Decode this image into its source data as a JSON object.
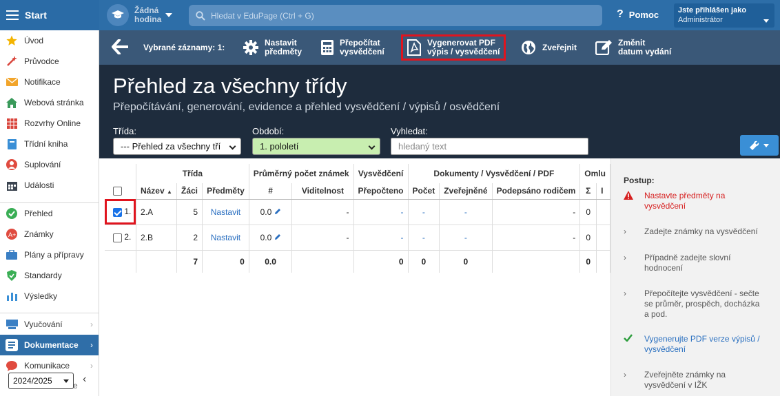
{
  "topbar": {
    "brand": "Start",
    "lesson_line1": "Žádná",
    "lesson_line2": "hodina",
    "search_placeholder": "Hledat v EduPage (Ctrl + G)",
    "help": "Pomoc",
    "login_line1": "Jste přihlášen jako",
    "login_line2": "Administrátor"
  },
  "sidebar": {
    "items": [
      {
        "label": "Úvod",
        "icon": "star-icon"
      },
      {
        "label": "Průvodce",
        "icon": "wand-icon"
      },
      {
        "label": "Notifikace",
        "icon": "envelope-icon"
      },
      {
        "label": "Webová stránka",
        "icon": "house-icon"
      },
      {
        "label": "Rozvrhy Online",
        "icon": "timetable-icon"
      },
      {
        "label": "Třídní kniha",
        "icon": "book-icon"
      },
      {
        "label": "Suplování",
        "icon": "person-icon"
      },
      {
        "label": "Události",
        "icon": "calendar-icon"
      },
      {
        "label": "Přehled",
        "icon": "check-circle-icon"
      },
      {
        "label": "Známky",
        "icon": "grades-icon"
      },
      {
        "label": "Plány a přípravy",
        "icon": "briefcase-icon"
      },
      {
        "label": "Standardy",
        "icon": "shield-icon"
      },
      {
        "label": "Výsledky",
        "icon": "bar-chart-icon"
      },
      {
        "label": "Vyučování",
        "icon": "classroom-icon"
      },
      {
        "label": "Dokumentace",
        "icon": "document-icon"
      },
      {
        "label": "Komunikace",
        "icon": "chat-icon"
      }
    ],
    "year": "2024/2025",
    "hidden_item_fragment": "e"
  },
  "toolbar": {
    "selected": "Vybrané záznamy: 1:",
    "btn_set_subjects_1": "Nastavit",
    "btn_set_subjects_2": "předměty",
    "btn_recalc_1": "Přepočítat",
    "btn_recalc_2": "vysvědčení",
    "btn_pdf_1": "Vygenerovat PDF",
    "btn_pdf_2": "výpis / vysvědčení",
    "btn_publish": "Zveřejnit",
    "btn_date_1": "Změnit",
    "btn_date_2": "datum vydání"
  },
  "page": {
    "title": "Přehled za všechny třídy",
    "subtitle": "Přepočítávání, generování, evidence a přehled vysvědčení / výpisů / osvědčení"
  },
  "filters": {
    "class_label": "Třída:",
    "class_value": "--- Přehled za všechny tří",
    "period_label": "Období:",
    "period_value": "1. pololetí",
    "search_label": "Vyhledat:",
    "search_placeholder": "hledaný text"
  },
  "table": {
    "groups": {
      "class": "Třída",
      "avg": "Průměrný počet známek",
      "cert": "Vysvědčení",
      "docs": "Dokumenty / Vysvědčení / PDF",
      "absence": "Omlu"
    },
    "headers": {
      "name": "Název",
      "sort_indicator": "▲",
      "students": "Žáci",
      "subjects": "Předměty",
      "count_hash": "#",
      "visibility": "Viditelnost",
      "recalc": "Přepočteno",
      "count": "Počet",
      "published": "Zveřejněné",
      "signed": "Podepsáno rodičem",
      "sigma": "Σ",
      "cut": "I"
    },
    "rows": [
      {
        "no": "1.",
        "name": "2.A",
        "students": "5",
        "subjects": "Nastavit",
        "avg": "0.0",
        "visibility": "-",
        "recalc": "-",
        "count": "-",
        "published": "-",
        "signed": "-",
        "sigma": "0",
        "checked": true
      },
      {
        "no": "2.",
        "name": "2.B",
        "students": "2",
        "subjects": "Nastavit",
        "avg": "0.0",
        "visibility": "-",
        "recalc": "-",
        "count": "-",
        "published": "-",
        "signed": "-",
        "sigma": "0",
        "checked": false
      }
    ],
    "totals": {
      "students": "7",
      "subjects": "0",
      "avg": "0.0",
      "recalc": "0",
      "count": "0",
      "published": "0",
      "sigma": "0"
    }
  },
  "procedure": {
    "title": "Postup:",
    "steps": [
      {
        "text1": "Nastavte předměty na",
        "text2": "vysvědčení",
        "text3": "",
        "text4": "",
        "state": "warning"
      },
      {
        "text1": "Zadejte známky na vysvědčení",
        "text2": "",
        "text3": "",
        "text4": "",
        "state": "todo"
      },
      {
        "text1": "Případně zadejte slovní",
        "text2": "hodnocení",
        "text3": "",
        "text4": "",
        "state": "todo"
      },
      {
        "text1": "Přepočítejte vysvědčení - sečte",
        "text2": "se průměr, prospěch, docházka",
        "text3": "a pod.",
        "text4": "",
        "state": "todo"
      },
      {
        "text1": "Vygenerujte PDF verze výpisů /",
        "text2": "vysvědčení",
        "text3": "",
        "text4": "",
        "state": "done"
      },
      {
        "text1": "Zveřejněte známky na",
        "text2": "vysvědčení v IŽK",
        "text3": "",
        "text4": "",
        "state": "todo"
      }
    ]
  },
  "colors": {
    "topbar": "#2d6ea8",
    "toolbar": "#3a5878",
    "header": "#1e2c3d",
    "highlight": "#e0141e",
    "link": "#2a6fc0",
    "warning": "#d62020",
    "done": "#2e9e3e"
  }
}
